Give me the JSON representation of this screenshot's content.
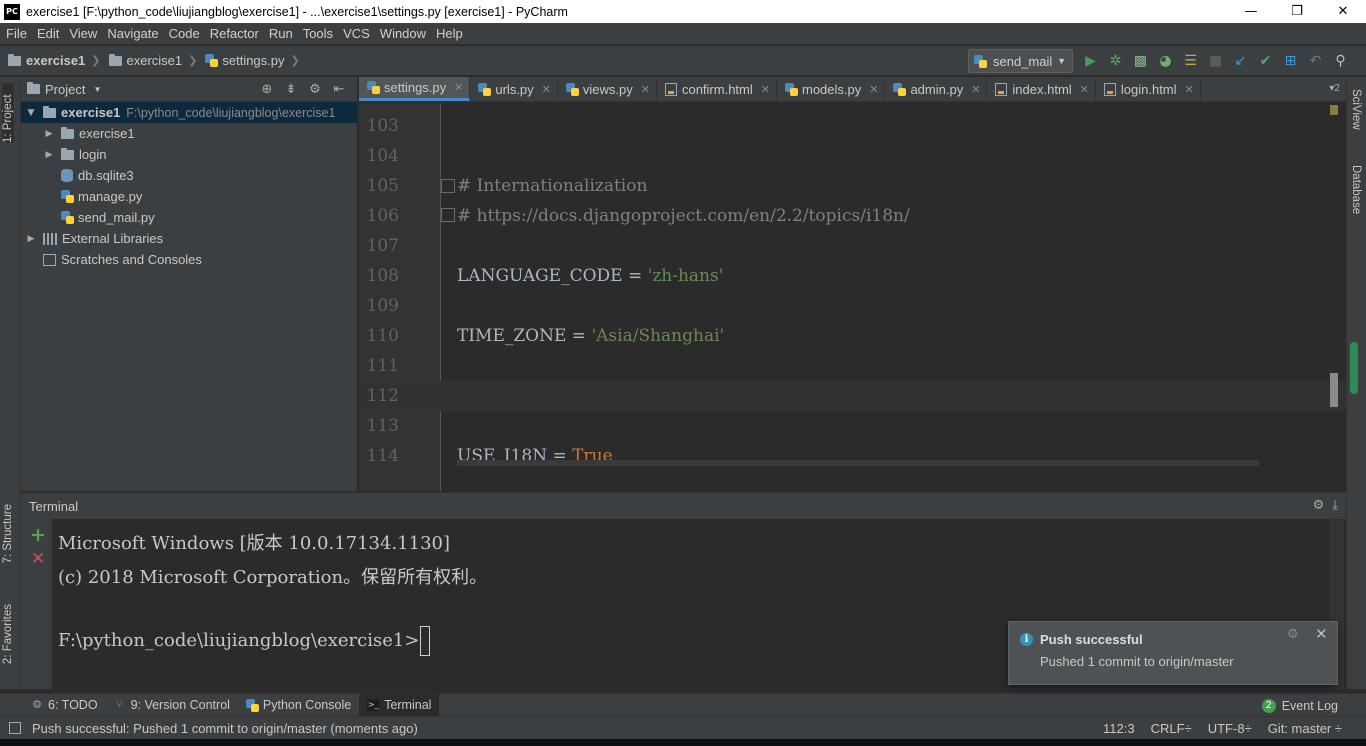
{
  "window": {
    "title": "exercise1 [F:\\python_code\\liujiangblog\\exercise1] - ...\\exercise1\\settings.py [exercise1] - PyCharm",
    "logo_text": "PC",
    "minimize": "—",
    "restore": "❐",
    "close": "✕"
  },
  "menu": [
    "File",
    "Edit",
    "View",
    "Navigate",
    "Code",
    "Refactor",
    "Run",
    "Tools",
    "VCS",
    "Window",
    "Help"
  ],
  "breadcrumb": [
    "exercise1",
    "exercise1",
    "settings.py"
  ],
  "run_config": {
    "label": "send_mail"
  },
  "toolbar_icons": [
    "run-icon",
    "debug-icon",
    "coverage-icon",
    "profile-icon",
    "concurrency-icon",
    "stop-icon",
    "vcs-update-icon",
    "vcs-commit-icon",
    "vcs-compare-icon",
    "undo-icon",
    "search-icon"
  ],
  "project_panel": {
    "title": "Project",
    "root": {
      "name": "exercise1",
      "path": "F:\\python_code\\liujiangblog\\exercise1"
    },
    "items": [
      {
        "name": "exercise1",
        "type": "folder"
      },
      {
        "name": "login",
        "type": "folder"
      },
      {
        "name": "db.sqlite3",
        "type": "db"
      },
      {
        "name": "manage.py",
        "type": "py"
      },
      {
        "name": "send_mail.py",
        "type": "py"
      }
    ],
    "external_libraries": "External Libraries",
    "scratches": "Scratches and Consoles"
  },
  "left_strip": {
    "project_tab": "1: Project",
    "structure_tab": "7: Structure",
    "favorites_tab": "2: Favorites"
  },
  "right_strip": {
    "sciview_tab": "SciView",
    "database_tab": "Database"
  },
  "tabs": [
    {
      "label": "settings.py",
      "type": "py",
      "active": true
    },
    {
      "label": "urls.py",
      "type": "py"
    },
    {
      "label": "views.py",
      "type": "py"
    },
    {
      "label": "confirm.html",
      "type": "html"
    },
    {
      "label": "models.py",
      "type": "py"
    },
    {
      "label": "admin.py",
      "type": "py"
    },
    {
      "label": "index.html",
      "type": "html"
    },
    {
      "label": "login.html",
      "type": "html"
    }
  ],
  "tabs_overflow": "▾2",
  "editor": {
    "lines": [
      {
        "n": "103",
        "code": ""
      },
      {
        "n": "104",
        "code": ""
      },
      {
        "n": "105",
        "code": "# Internationalization"
      },
      {
        "n": "106",
        "code": "# https://docs.djangoproject.com/en/2.2/topics/i18n/"
      },
      {
        "n": "107",
        "code": ""
      },
      {
        "n": "108",
        "code_a": "LANGUAGE_CODE = ",
        "code_b": "'zh-hans'"
      },
      {
        "n": "109",
        "code": ""
      },
      {
        "n": "110",
        "code_a": "TIME_ZONE = ",
        "code_b": "'Asia/Shanghai'"
      },
      {
        "n": "111",
        "code": ""
      },
      {
        "n": "112",
        "code": ""
      },
      {
        "n": "113",
        "code": ""
      },
      {
        "n": "114",
        "code_a": "USE_I18N = ",
        "code_b": "True"
      }
    ]
  },
  "terminal": {
    "title": "Terminal",
    "lines": [
      "Microsoft Windows [版本 10.0.17134.1130]",
      "(c) 2018 Microsoft Corporation。保留所有权利。",
      "",
      "F:\\python_code\\liujiangblog\\exercise1>"
    ]
  },
  "notification": {
    "title": "Push successful",
    "body": "Pushed 1 commit to origin/master"
  },
  "tool_windows": [
    {
      "label": "6: TODO",
      "icon": "todo-icon"
    },
    {
      "label": "9: Version Control",
      "icon": "vcs-icon"
    },
    {
      "label": "Python Console",
      "icon": "python-console-icon"
    },
    {
      "label": "Terminal",
      "icon": "terminal-icon",
      "active": true
    }
  ],
  "event_log": {
    "count": "2",
    "label": "Event Log"
  },
  "status": {
    "message": "Push successful: Pushed 1 commit to origin/master (moments ago)",
    "position": "112:3",
    "line_sep": "CRLF÷",
    "encoding": "UTF-8÷",
    "git": "Git: master ÷"
  }
}
